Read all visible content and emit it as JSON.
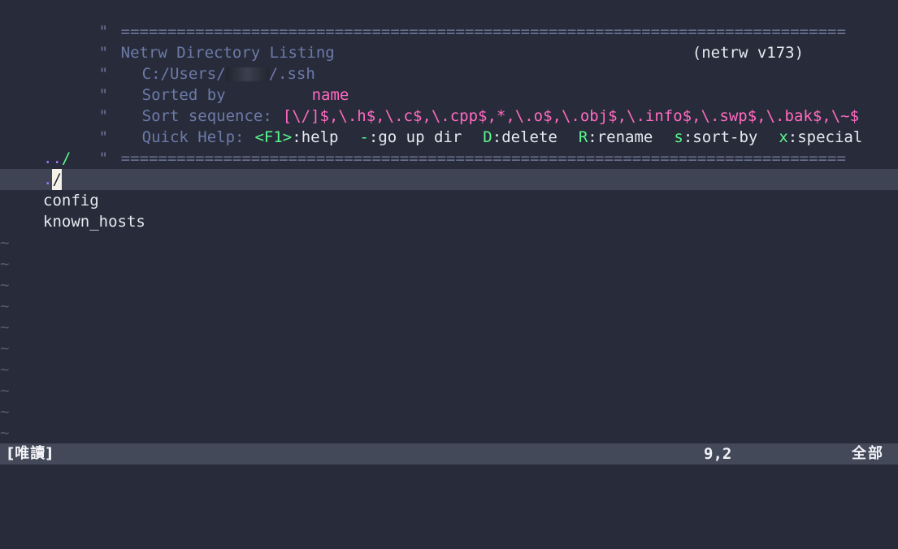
{
  "window": {
    "app": "vim",
    "background": "#282c3a",
    "foreground": "#e6e9ef"
  },
  "colors": {
    "comment": "#6b7394",
    "label": "#6c7aa8",
    "pink": "#ff6ac1",
    "green": "#5af78e",
    "white": "#e6e9ef",
    "purple": "#a277ff",
    "cursorline": "#3f4455",
    "cursor": "#f5f2e7",
    "statusline_bg": "#434959",
    "statusline_fg": "#f0f2f6"
  },
  "banner": {
    "comment_mark": "\"",
    "rule_top": "==============================================================================",
    "rule_bottom": "==============================================================================",
    "title": "Netrw Directory Listing",
    "version": "(netrw v173)",
    "path_prefix": "C:/Users/",
    "path_redacted": "",
    "path_suffix": "/.ssh",
    "sorted_by_label": "Sorted by",
    "sorted_by_value": "name",
    "sort_sequence_label": "Sort sequence:",
    "sort_sequence_value": "[\\/]$,\\.h$,\\.c$,\\.cpp$,*,\\.o$,\\.obj$,\\.info$,\\.swp$,\\.bak$,\\~$",
    "quick_help_label": "Quick Help:",
    "quick_help_items": [
      {
        "key": "<F1>",
        "action": ":help"
      },
      {
        "key": "-",
        "action": ":go up dir"
      },
      {
        "key": "D",
        "action": ":delete"
      },
      {
        "key": "R",
        "action": ":rename"
      },
      {
        "key": "s",
        "action": ":sort-by"
      },
      {
        "key": "x",
        "action": ":special"
      }
    ]
  },
  "listing": {
    "entries": [
      {
        "dots": "..",
        "slash": "/",
        "name": "",
        "type": "dir",
        "selected": false
      },
      {
        "dots": ".",
        "slash": "/",
        "name": "",
        "type": "dir",
        "selected": true
      },
      {
        "dots": "",
        "slash": "",
        "name": "config",
        "type": "file",
        "selected": false
      },
      {
        "dots": "",
        "slash": "",
        "name": "known_hosts",
        "type": "file",
        "selected": false
      }
    ]
  },
  "empty_marker": "~",
  "empty_line_count": 10,
  "statusline": {
    "readonly": "[唯讀]",
    "ruler": "9,2",
    "position": "全部"
  },
  "cmdline": {
    "text": ""
  }
}
